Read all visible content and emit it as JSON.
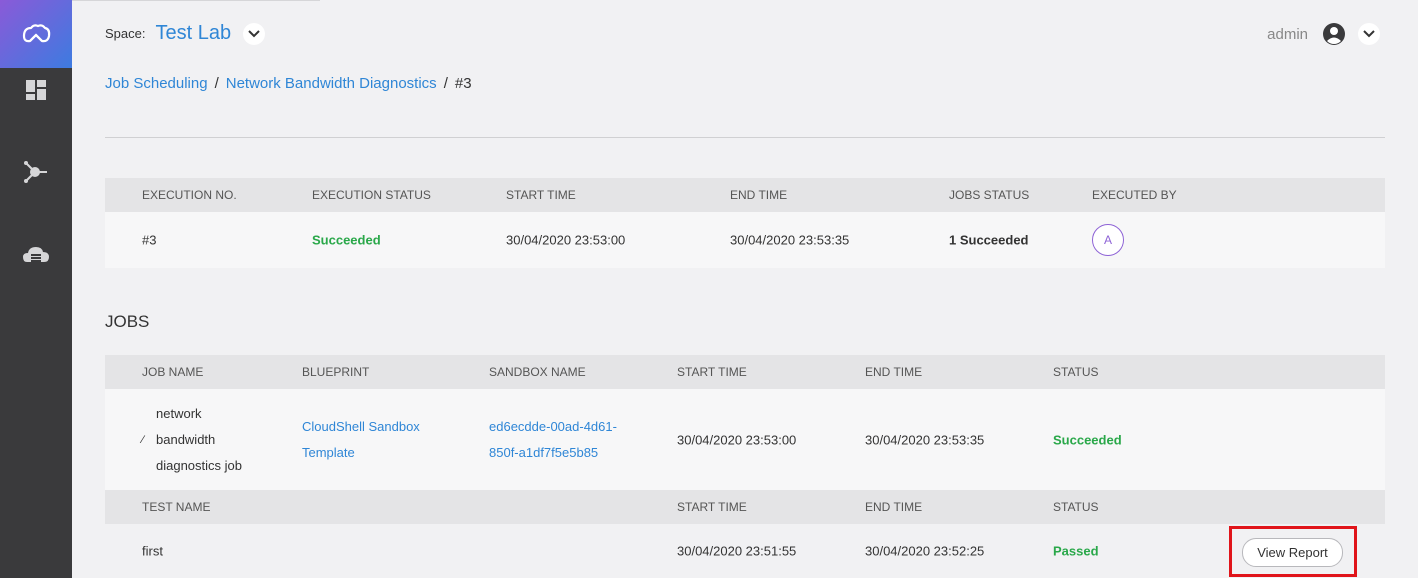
{
  "sidebar": {
    "items": [
      {
        "icon": "dashboard-icon"
      },
      {
        "icon": "blueprint-icon"
      },
      {
        "icon": "cloud-storage-icon"
      }
    ]
  },
  "header": {
    "space_label": "Space:",
    "space_name": "Test Lab",
    "user_name": "admin"
  },
  "breadcrumb": {
    "items": [
      "Job Scheduling",
      "Network Bandwidth Diagnostics"
    ],
    "current": "#3",
    "separator": "/"
  },
  "execution_table": {
    "headers": [
      "EXECUTION NO.",
      "EXECUTION STATUS",
      "START TIME",
      "END TIME",
      "JOBS STATUS",
      "EXECUTED BY"
    ],
    "row": {
      "execution_no": "#3",
      "status": "Succeeded",
      "start_time": "30/04/2020 23:53:00",
      "end_time": "30/04/2020 23:53:35",
      "jobs_status": "1 Succeeded",
      "executed_by": "A"
    }
  },
  "jobs": {
    "title": "JOBS",
    "headers": [
      "JOB NAME",
      "BLUEPRINT",
      "SANDBOX NAME",
      "START TIME",
      "END TIME",
      "STATUS"
    ],
    "row": {
      "job_name_lines": [
        "network",
        "bandwidth",
        "diagnostics job"
      ],
      "blueprint_lines": [
        "CloudShell Sandbox",
        "Template"
      ],
      "sandbox_lines": [
        "ed6ecdde-00ad-4d61-",
        "850f-a1df7f5e5b85"
      ],
      "start_time": "30/04/2020 23:53:00",
      "end_time": "30/04/2020 23:53:35",
      "status": "Succeeded"
    },
    "test_headers": [
      "TEST NAME",
      "START TIME",
      "END TIME",
      "STATUS"
    ],
    "test_row": {
      "test_name": "first",
      "start_time": "30/04/2020 23:51:55",
      "end_time": "30/04/2020 23:52:25",
      "status": "Passed",
      "action_label": "View Report"
    }
  },
  "colors": {
    "accent": "#2f86d6",
    "success": "#2aa84a",
    "highlight": "#e0141a",
    "sidebar": "#3a3a3c"
  }
}
